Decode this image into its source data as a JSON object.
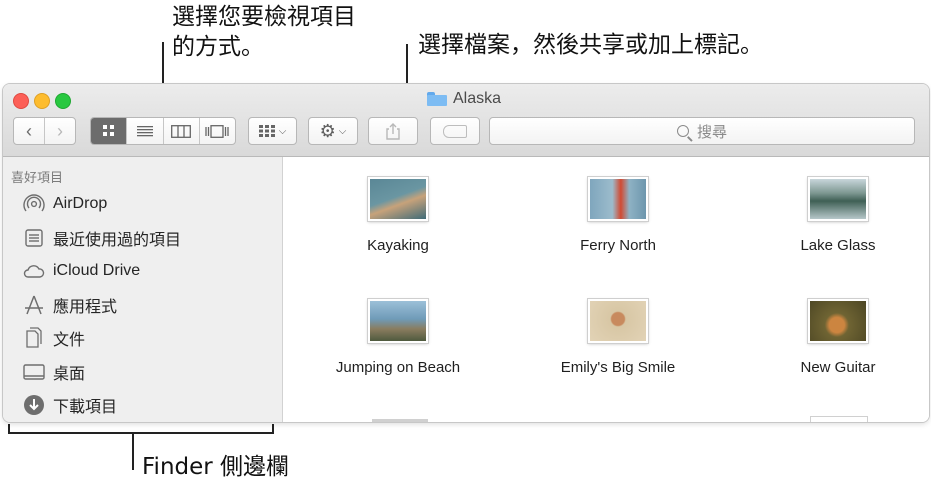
{
  "callouts": {
    "view_mode": "選擇您要檢視項目的方式。",
    "share": "選擇檔案，然後共享或加上標記。",
    "sidebar": "Finder 側邊欄"
  },
  "window": {
    "title": "Alaska",
    "search_placeholder": "搜尋"
  },
  "toolbar": {
    "back": "‹",
    "forward": "›",
    "views": [
      "icon-view-icon",
      "list-view-icon",
      "column-view-icon",
      "gallery-view-icon"
    ],
    "group_icon": "group-icon",
    "action_icon": "gear-icon",
    "share_icon": "share-icon",
    "tag_icon": "tag-icon"
  },
  "sidebar": {
    "section_title": "喜好項目",
    "items": [
      {
        "label": "AirDrop",
        "icon": "airdrop-icon"
      },
      {
        "label": "最近使用過的項目",
        "icon": "recents-icon"
      },
      {
        "label": "iCloud Drive",
        "icon": "cloud-icon"
      },
      {
        "label": "應用程式",
        "icon": "applications-icon"
      },
      {
        "label": "文件",
        "icon": "documents-icon"
      },
      {
        "label": "桌面",
        "icon": "desktop-icon"
      },
      {
        "label": "下載項目",
        "icon": "downloads-icon"
      }
    ]
  },
  "files": [
    {
      "name": "Kayaking",
      "colors": [
        "#4a7c8c",
        "#c7a27a"
      ]
    },
    {
      "name": "Ferry North",
      "colors": [
        "#5f8aa6",
        "#d14a32"
      ]
    },
    {
      "name": "Lake Glass",
      "colors": [
        "#3f5f55",
        "#b6c7c9"
      ]
    },
    {
      "name": "Jumping on Beach",
      "colors": [
        "#6f9bb8",
        "#8a7c5f"
      ]
    },
    {
      "name": "Emily's Big Smile",
      "colors": [
        "#d8c7a5",
        "#c88a5e"
      ]
    },
    {
      "name": "New Guitar",
      "colors": [
        "#6f6433",
        "#cc8540"
      ]
    }
  ]
}
